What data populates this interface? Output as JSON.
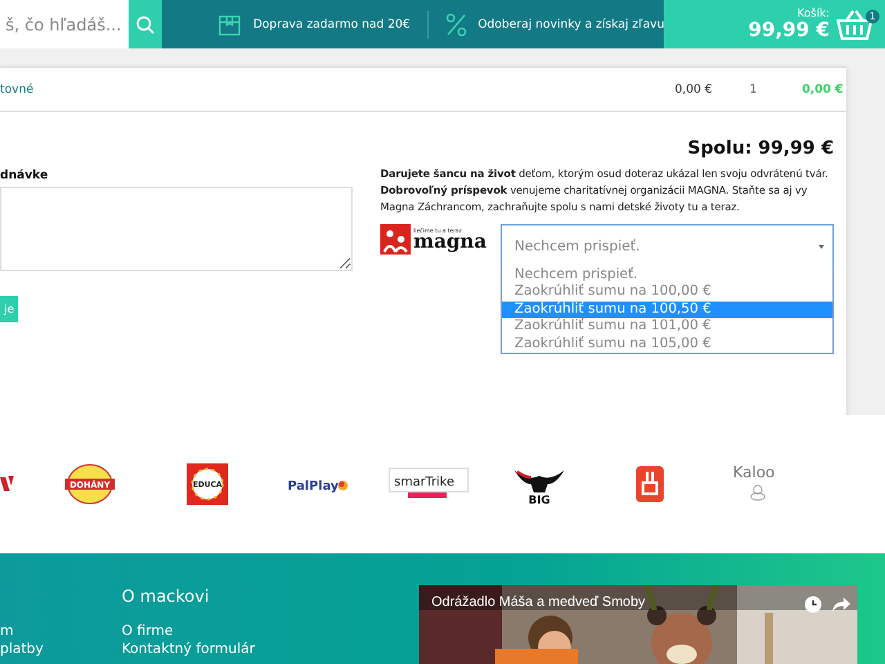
{
  "header": {
    "search": {
      "placeholder": "š, čo hľadáš..."
    },
    "perks": [
      {
        "kind": "box",
        "text": "Doprava zadarmo nad 20€"
      },
      {
        "kind": "percent",
        "text": "Odoberaj novinky a získaj zľavu"
      }
    ],
    "cart": {
      "label": "Košík:",
      "total": "99,99 €",
      "count": "1"
    }
  },
  "cart_rows": [
    {
      "name": "tovné",
      "price": "0,00 €",
      "quantity": "1",
      "total": "0,00 €"
    }
  ],
  "summary": {
    "total": "Spolu: 99,99 €"
  },
  "note": {
    "label": "dnávke",
    "button": "je"
  },
  "donation": {
    "text": "**Darujete šancu na život** deťom, ktorým osud doteraz ukázal len svoju odvrátenú tvár. **Dobrovoľný príspevok** venujeme charitatívnej organizácii MAGNA. Staňte sa aj vy Magna Záchrancom, zachraňujte spolu s nami detské životy tu a teraz.",
    "logo": {
      "tagline": "liečime tu a teraz",
      "name": "magna"
    },
    "select": {
      "value": "Nechcem prispieť.",
      "expanded": true,
      "options": [
        {
          "label": "Nechcem prispieť.",
          "highlighted": false
        },
        {
          "label": "Zaokrúhliť sumu na 100,00 €",
          "highlighted": false
        },
        {
          "label": "Zaokrúhliť sumu na 100,50 €",
          "highlighted": true
        },
        {
          "label": "Zaokrúhliť sumu na 101,00 €",
          "highlighted": false
        },
        {
          "label": "Zaokrúhliť sumu na 105,00 €",
          "highlighted": false
        }
      ]
    }
  },
  "brands": [
    {
      "kind": "partial"
    },
    {
      "kind": "dohany",
      "name": "DOHÁNY"
    },
    {
      "kind": "educa",
      "name": "EDUCA"
    },
    {
      "kind": "palplay",
      "name": "PalPlay"
    },
    {
      "kind": "smartrike",
      "name": "smarTrike"
    },
    {
      "kind": "big",
      "name": "BIG"
    },
    {
      "kind": "rabbit"
    },
    {
      "kind": "kaloo",
      "name": "Kaloo"
    }
  ],
  "footer": {
    "left_links": [
      "m",
      "platby"
    ],
    "heading": "O mackovi",
    "links": [
      "O firme",
      "Kontaktný formulár"
    ],
    "video": {
      "title": "Odrážadlo Máša a medveď Smoby"
    }
  }
}
